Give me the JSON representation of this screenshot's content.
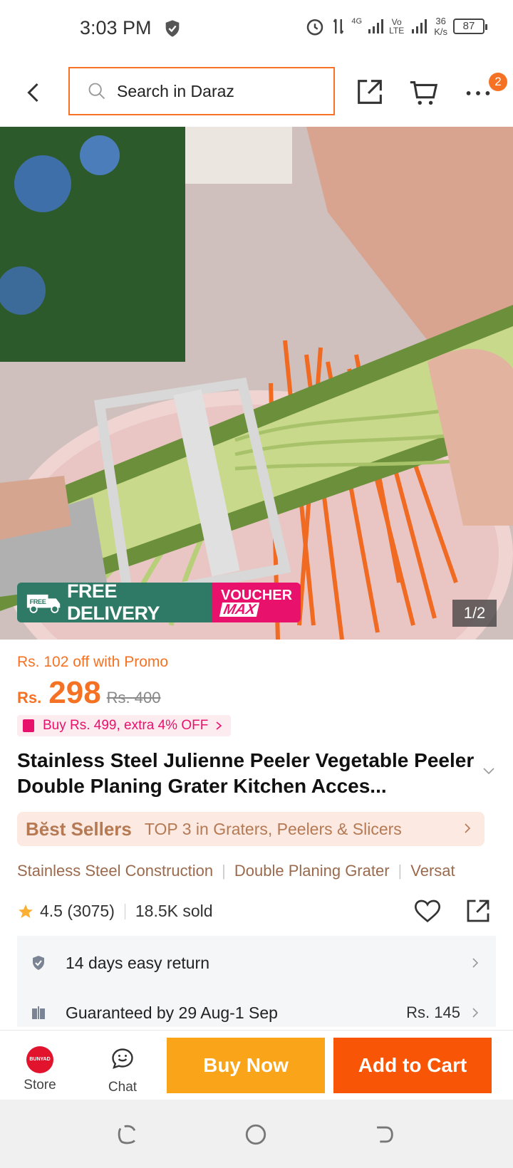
{
  "status_bar": {
    "time": "3:03 PM",
    "network_speed": "36",
    "network_unit": "K/s",
    "battery": "87",
    "net_4g": "4G",
    "volte_top": "Vo",
    "volte_bottom": "LTE"
  },
  "header": {
    "search_placeholder": "Search in Daraz",
    "cart_badge": "2"
  },
  "hero": {
    "free_delivery_label": "FREE DELIVERY",
    "free_tag": "FREE",
    "voucher_top": "VOUCHER",
    "voucher_bottom": "MAX",
    "image_counter": "1/2"
  },
  "pricing": {
    "promo_text": "Rs. 102 off with Promo",
    "currency": "Rs.",
    "price": "298",
    "old_price": "Rs. 400",
    "extra_offer": "Buy Rs. 499, extra 4% OFF"
  },
  "product": {
    "title": "Stainless Steel Julienne Peeler Vegetable Peeler Double Planing Grater Kitchen Acces..."
  },
  "best_seller": {
    "label": "Bĕst Sellers",
    "text": "TOP 3 in Graters, Peelers & Slicers"
  },
  "tags": [
    "Stainless Steel Construction",
    "Double Planing Grater",
    "Versat"
  ],
  "rating": {
    "score": "4.5 (3075)",
    "sold": "18.5K sold"
  },
  "services": {
    "return_text": "14 days easy return",
    "delivery_text": "Guaranteed by 29 Aug-1 Sep",
    "delivery_fee": "Rs. 145"
  },
  "bottom_bar": {
    "store_label": "Store",
    "store_logo_text": "BUNYAD",
    "chat_label": "Chat",
    "buy_now": "Buy Now",
    "add_to_cart": "Add to Cart"
  },
  "colors": {
    "accent": "#f57224",
    "buy_now": "#faa41a",
    "add_to_cart": "#f85606",
    "free_delivery": "#2f7a66",
    "voucher": "#e8116b"
  }
}
